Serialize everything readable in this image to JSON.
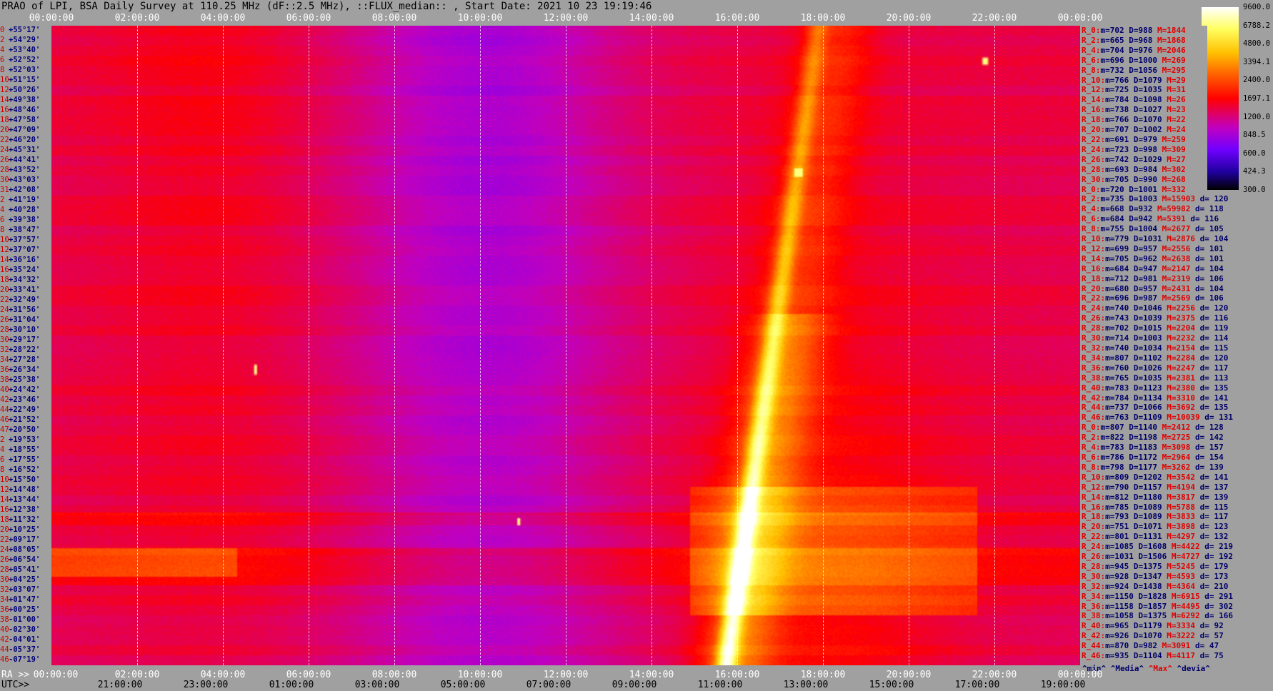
{
  "title": "PRAO of LPI, BSA Daily Survey at 110.25 MHz (dF::2.5 MHz), ::FLUX_median:: , Start Date: 2021 10 23 19:19:46",
  "chart_data": {
    "type": "heatmap",
    "title": "PRAO of LPI, BSA Daily Survey at 110.25 MHz (dF::2.5 MHz), ::FLUX_median:: , Start Date: 2021 10 23 19:19:46",
    "top_axis_ticks": [
      "00:00:00",
      "02:00:00",
      "04:00:00",
      "06:00:00",
      "08:00:00",
      "10:00:00",
      "12:00:00",
      "14:00:00",
      "16:00:00",
      "18:00:00",
      "20:00:00",
      "22:00:00",
      "00:00:00"
    ],
    "ra_label": "RA >>",
    "ra_ticks": [
      "00:00:00",
      "02:00:00",
      "04:00:00",
      "06:00:00",
      "08:00:00",
      "10:00:00",
      "12:00:00",
      "14:00:00",
      "16:00:00",
      "18:00:00",
      "20:00:00",
      "22:00:00",
      "00:00:00"
    ],
    "utc_label": "UTC>>",
    "utc_ticks": [
      "21:00:00",
      "23:00:00",
      "01:00:00",
      "03:00:00",
      "05:00:00",
      "07:00:00",
      "09:00:00",
      "11:00:00",
      "13:00:00",
      "15:00:00",
      "17:00:00",
      "19:00:00"
    ],
    "colorbar": {
      "ticks": [
        "9600.0",
        "6788.2",
        "4800.0",
        "3394.1",
        "2400.0",
        "1697.1",
        "1200.0",
        "848.5",
        "600.0",
        "424.3",
        "300.0"
      ],
      "min": 300.0,
      "max": 9600.0,
      "scale": "log"
    },
    "rows": [
      {
        "idx": "0",
        "dec": "+55°17'"
      },
      {
        "idx": "2",
        "dec": "+54°29'"
      },
      {
        "idx": "4",
        "dec": "+53°40'"
      },
      {
        "idx": "6",
        "dec": "+52°52'"
      },
      {
        "idx": "8",
        "dec": "+52°03'"
      },
      {
        "idx": "10",
        "dec": "+51°15'"
      },
      {
        "idx": "12",
        "dec": "+50°26'"
      },
      {
        "idx": "14",
        "dec": "+49°38'"
      },
      {
        "idx": "16",
        "dec": "+48°46'"
      },
      {
        "idx": "18",
        "dec": "+47°58'"
      },
      {
        "idx": "20",
        "dec": "+47°09'"
      },
      {
        "idx": "22",
        "dec": "+46°20'"
      },
      {
        "idx": "24",
        "dec": "+45°31'"
      },
      {
        "idx": "26",
        "dec": "+44°41'"
      },
      {
        "idx": "28",
        "dec": "+43°52'"
      },
      {
        "idx": "30",
        "dec": "+43°03'"
      },
      {
        "idx": "31",
        "dec": "+42°08'"
      },
      {
        "idx": "2",
        "dec": "+41°19'"
      },
      {
        "idx": "4",
        "dec": "+40°28'"
      },
      {
        "idx": "6",
        "dec": "+39°38'"
      },
      {
        "idx": "8",
        "dec": "+38°47'"
      },
      {
        "idx": "10",
        "dec": "+37°57'"
      },
      {
        "idx": "12",
        "dec": "+37°07'"
      },
      {
        "idx": "14",
        "dec": "+36°16'"
      },
      {
        "idx": "16",
        "dec": "+35°24'"
      },
      {
        "idx": "18",
        "dec": "+34°32'"
      },
      {
        "idx": "20",
        "dec": "+33°41'"
      },
      {
        "idx": "22",
        "dec": "+32°49'"
      },
      {
        "idx": "24",
        "dec": "+31°56'"
      },
      {
        "idx": "26",
        "dec": "+31°04'"
      },
      {
        "idx": "28",
        "dec": "+30°10'"
      },
      {
        "idx": "30",
        "dec": "+29°17'"
      },
      {
        "idx": "32",
        "dec": "+28°22'"
      },
      {
        "idx": "34",
        "dec": "+27°28'"
      },
      {
        "idx": "36",
        "dec": "+26°34'"
      },
      {
        "idx": "38",
        "dec": "+25°38'"
      },
      {
        "idx": "40",
        "dec": "+24°42'"
      },
      {
        "idx": "42",
        "dec": "+23°46'"
      },
      {
        "idx": "44",
        "dec": "+22°49'"
      },
      {
        "idx": "46",
        "dec": "+21°52'"
      },
      {
        "idx": "47",
        "dec": "+20°50'"
      },
      {
        "idx": "2",
        "dec": "+19°53'"
      },
      {
        "idx": "4",
        "dec": "+18°55'"
      },
      {
        "idx": "6",
        "dec": "+17°55'"
      },
      {
        "idx": "8",
        "dec": "+16°52'"
      },
      {
        "idx": "10",
        "dec": "+15°50'"
      },
      {
        "idx": "12",
        "dec": "+14°48'"
      },
      {
        "idx": "14",
        "dec": "+13°44'"
      },
      {
        "idx": "16",
        "dec": "+12°38'"
      },
      {
        "idx": "18",
        "dec": "+11°32'"
      },
      {
        "idx": "20",
        "dec": "+10°25'"
      },
      {
        "idx": "22",
        "dec": "+09°17'"
      },
      {
        "idx": "24",
        "dec": "+08°05'"
      },
      {
        "idx": "26",
        "dec": "+06°54'"
      },
      {
        "idx": "28",
        "dec": "+05°41'"
      },
      {
        "idx": "30",
        "dec": "+04°25'"
      },
      {
        "idx": "32",
        "dec": "+03°07'"
      },
      {
        "idx": "34",
        "dec": "+01°47'"
      },
      {
        "idx": "36",
        "dec": "+00°25'"
      },
      {
        "idx": "38",
        "dec": "-01°00'"
      },
      {
        "idx": "40",
        "dec": "-02°30'"
      },
      {
        "idx": "42",
        "dec": "-04°01'"
      },
      {
        "idx": "44",
        "dec": "-05°37'"
      },
      {
        "idx": "46",
        "dec": "-07°19'"
      }
    ],
    "stats": [
      {
        "r": "R_0:",
        "min": "702",
        "med": "988",
        "max": "1844",
        "dev": ""
      },
      {
        "r": "R_2:",
        "min": "665",
        "med": "968",
        "max": "1868",
        "dev": ""
      },
      {
        "r": "R_4:",
        "min": "704",
        "med": "976",
        "max": "2046",
        "dev": ""
      },
      {
        "r": "R_6:",
        "min": "696",
        "med": "1000",
        "max": "269",
        "dev": ""
      },
      {
        "r": "R_8:",
        "min": "732",
        "med": "1056",
        "max": "295",
        "dev": ""
      },
      {
        "r": "R_10:",
        "min": "766",
        "med": "1079",
        "max": "29",
        "dev": ""
      },
      {
        "r": "R_12:",
        "min": "725",
        "med": "1035",
        "max": "31",
        "dev": ""
      },
      {
        "r": "R_14:",
        "min": "784",
        "med": "1098",
        "max": "26",
        "dev": ""
      },
      {
        "r": "R_16:",
        "min": "738",
        "med": "1027",
        "max": "23",
        "dev": ""
      },
      {
        "r": "R_18:",
        "min": "766",
        "med": "1070",
        "max": "22",
        "dev": ""
      },
      {
        "r": "R_20:",
        "min": "707",
        "med": "1002",
        "max": "24",
        "dev": ""
      },
      {
        "r": "R_22:",
        "min": "691",
        "med": "979",
        "max": "259",
        "dev": ""
      },
      {
        "r": "R_24:",
        "min": "723",
        "med": "998",
        "max": "309",
        "dev": ""
      },
      {
        "r": "R_26:",
        "min": "742",
        "med": "1029",
        "max": "27",
        "dev": ""
      },
      {
        "r": "R_28:",
        "min": "693",
        "med": "984",
        "max": "302",
        "dev": ""
      },
      {
        "r": "R_30:",
        "min": "705",
        "med": "990",
        "max": "268",
        "dev": ""
      },
      {
        "r": "R_0:",
        "min": "720",
        "med": "1001",
        "max": "332",
        "dev": ""
      },
      {
        "r": "R_2:",
        "min": "735",
        "med": "1003",
        "max": "15903",
        "dev": "120"
      },
      {
        "r": "R_4:",
        "min": "668",
        "med": "932",
        "max": "59982",
        "dev": "118"
      },
      {
        "r": "R_6:",
        "min": "684",
        "med": "942",
        "max": "5391",
        "dev": "116"
      },
      {
        "r": "R_8:",
        "min": "755",
        "med": "1004",
        "max": "2677",
        "dev": "105"
      },
      {
        "r": "R_10:",
        "min": "779",
        "med": "1031",
        "max": "2876",
        "dev": "104"
      },
      {
        "r": "R_12:",
        "min": "699",
        "med": "957",
        "max": "2556",
        "dev": "101"
      },
      {
        "r": "R_14:",
        "min": "705",
        "med": "962",
        "max": "2638",
        "dev": "101"
      },
      {
        "r": "R_16:",
        "min": "684",
        "med": "947",
        "max": "2147",
        "dev": "104"
      },
      {
        "r": "R_18:",
        "min": "712",
        "med": "981",
        "max": "2319",
        "dev": "106"
      },
      {
        "r": "R_20:",
        "min": "680",
        "med": "957",
        "max": "2431",
        "dev": "104"
      },
      {
        "r": "R_22:",
        "min": "696",
        "med": "987",
        "max": "2569",
        "dev": "106"
      },
      {
        "r": "R_24:",
        "min": "740",
        "med": "1046",
        "max": "2256",
        "dev": "120"
      },
      {
        "r": "R_26:",
        "min": "743",
        "med": "1039",
        "max": "2375",
        "dev": "116"
      },
      {
        "r": "R_28:",
        "min": "702",
        "med": "1015",
        "max": "2204",
        "dev": "119"
      },
      {
        "r": "R_30:",
        "min": "714",
        "med": "1003",
        "max": "2232",
        "dev": "114"
      },
      {
        "r": "R_32:",
        "min": "740",
        "med": "1034",
        "max": "2154",
        "dev": "115"
      },
      {
        "r": "R_34:",
        "min": "807",
        "med": "1102",
        "max": "2284",
        "dev": "120"
      },
      {
        "r": "R_36:",
        "min": "760",
        "med": "1026",
        "max": "2247",
        "dev": "117"
      },
      {
        "r": "R_38:",
        "min": "765",
        "med": "1035",
        "max": "2381",
        "dev": "113"
      },
      {
        "r": "R_40:",
        "min": "783",
        "med": "1123",
        "max": "2380",
        "dev": "135"
      },
      {
        "r": "R_42:",
        "min": "784",
        "med": "1134",
        "max": "3310",
        "dev": "141"
      },
      {
        "r": "R_44:",
        "min": "737",
        "med": "1066",
        "max": "3692",
        "dev": "135"
      },
      {
        "r": "R_46:",
        "min": "763",
        "med": "1109",
        "max": "10039",
        "dev": "131"
      },
      {
        "r": "R_0:",
        "min": "807",
        "med": "1140",
        "max": "2412",
        "dev": "128"
      },
      {
        "r": "R_2:",
        "min": "822",
        "med": "1198",
        "max": "2725",
        "dev": "142"
      },
      {
        "r": "R_4:",
        "min": "783",
        "med": "1183",
        "max": "3098",
        "dev": "157"
      },
      {
        "r": "R_6:",
        "min": "786",
        "med": "1172",
        "max": "2964",
        "dev": "154"
      },
      {
        "r": "R_8:",
        "min": "798",
        "med": "1177",
        "max": "3262",
        "dev": "139"
      },
      {
        "r": "R_10:",
        "min": "809",
        "med": "1202",
        "max": "3542",
        "dev": "141"
      },
      {
        "r": "R_12:",
        "min": "790",
        "med": "1157",
        "max": "4194",
        "dev": "137"
      },
      {
        "r": "R_14:",
        "min": "812",
        "med": "1180",
        "max": "3817",
        "dev": "139"
      },
      {
        "r": "R_16:",
        "min": "785",
        "med": "1089",
        "max": "5788",
        "dev": "115"
      },
      {
        "r": "R_18:",
        "min": "793",
        "med": "1089",
        "max": "3833",
        "dev": "117"
      },
      {
        "r": "R_20:",
        "min": "751",
        "med": "1071",
        "max": "3898",
        "dev": "123"
      },
      {
        "r": "R_22:",
        "min": "801",
        "med": "1131",
        "max": "4297",
        "dev": "132"
      },
      {
        "r": "R_24:",
        "min": "1085",
        "med": "1608",
        "max": "4422",
        "dev": "219"
      },
      {
        "r": "R_26:",
        "min": "1031",
        "med": "1506",
        "max": "4727",
        "dev": "192"
      },
      {
        "r": "R_28:",
        "min": "945",
        "med": "1375",
        "max": "5245",
        "dev": "179"
      },
      {
        "r": "R_30:",
        "min": "928",
        "med": "1347",
        "max": "4593",
        "dev": "173"
      },
      {
        "r": "R_32:",
        "min": "924",
        "med": "1438",
        "max": "4364",
        "dev": "210"
      },
      {
        "r": "R_34:",
        "min": "1150",
        "med": "1828",
        "max": "6915",
        "dev": "291"
      },
      {
        "r": "R_36:",
        "min": "1158",
        "med": "1857",
        "max": "4495",
        "dev": "302"
      },
      {
        "r": "R_38:",
        "min": "1058",
        "med": "1375",
        "max": "6292",
        "dev": "166"
      },
      {
        "r": "R_40:",
        "min": "965",
        "med": "1179",
        "max": "3334",
        "dev": "92"
      },
      {
        "r": "R_42:",
        "min": "926",
        "med": "1070",
        "max": "3222",
        "dev": "57"
      },
      {
        "r": "R_44:",
        "min": "870",
        "med": "982",
        "max": "3091",
        "dev": "47"
      },
      {
        "r": "R_46:",
        "min": "935",
        "med": "1104",
        "max": "4117",
        "dev": "75"
      }
    ],
    "stat_legend": {
      "min": "^min^",
      "med": "^Media^",
      "max": "^Max^",
      "dev": "^devia^"
    }
  },
  "colors": {
    "background": "#a0a0a0",
    "label_red": "#d00000",
    "label_blue": "#00007a"
  }
}
